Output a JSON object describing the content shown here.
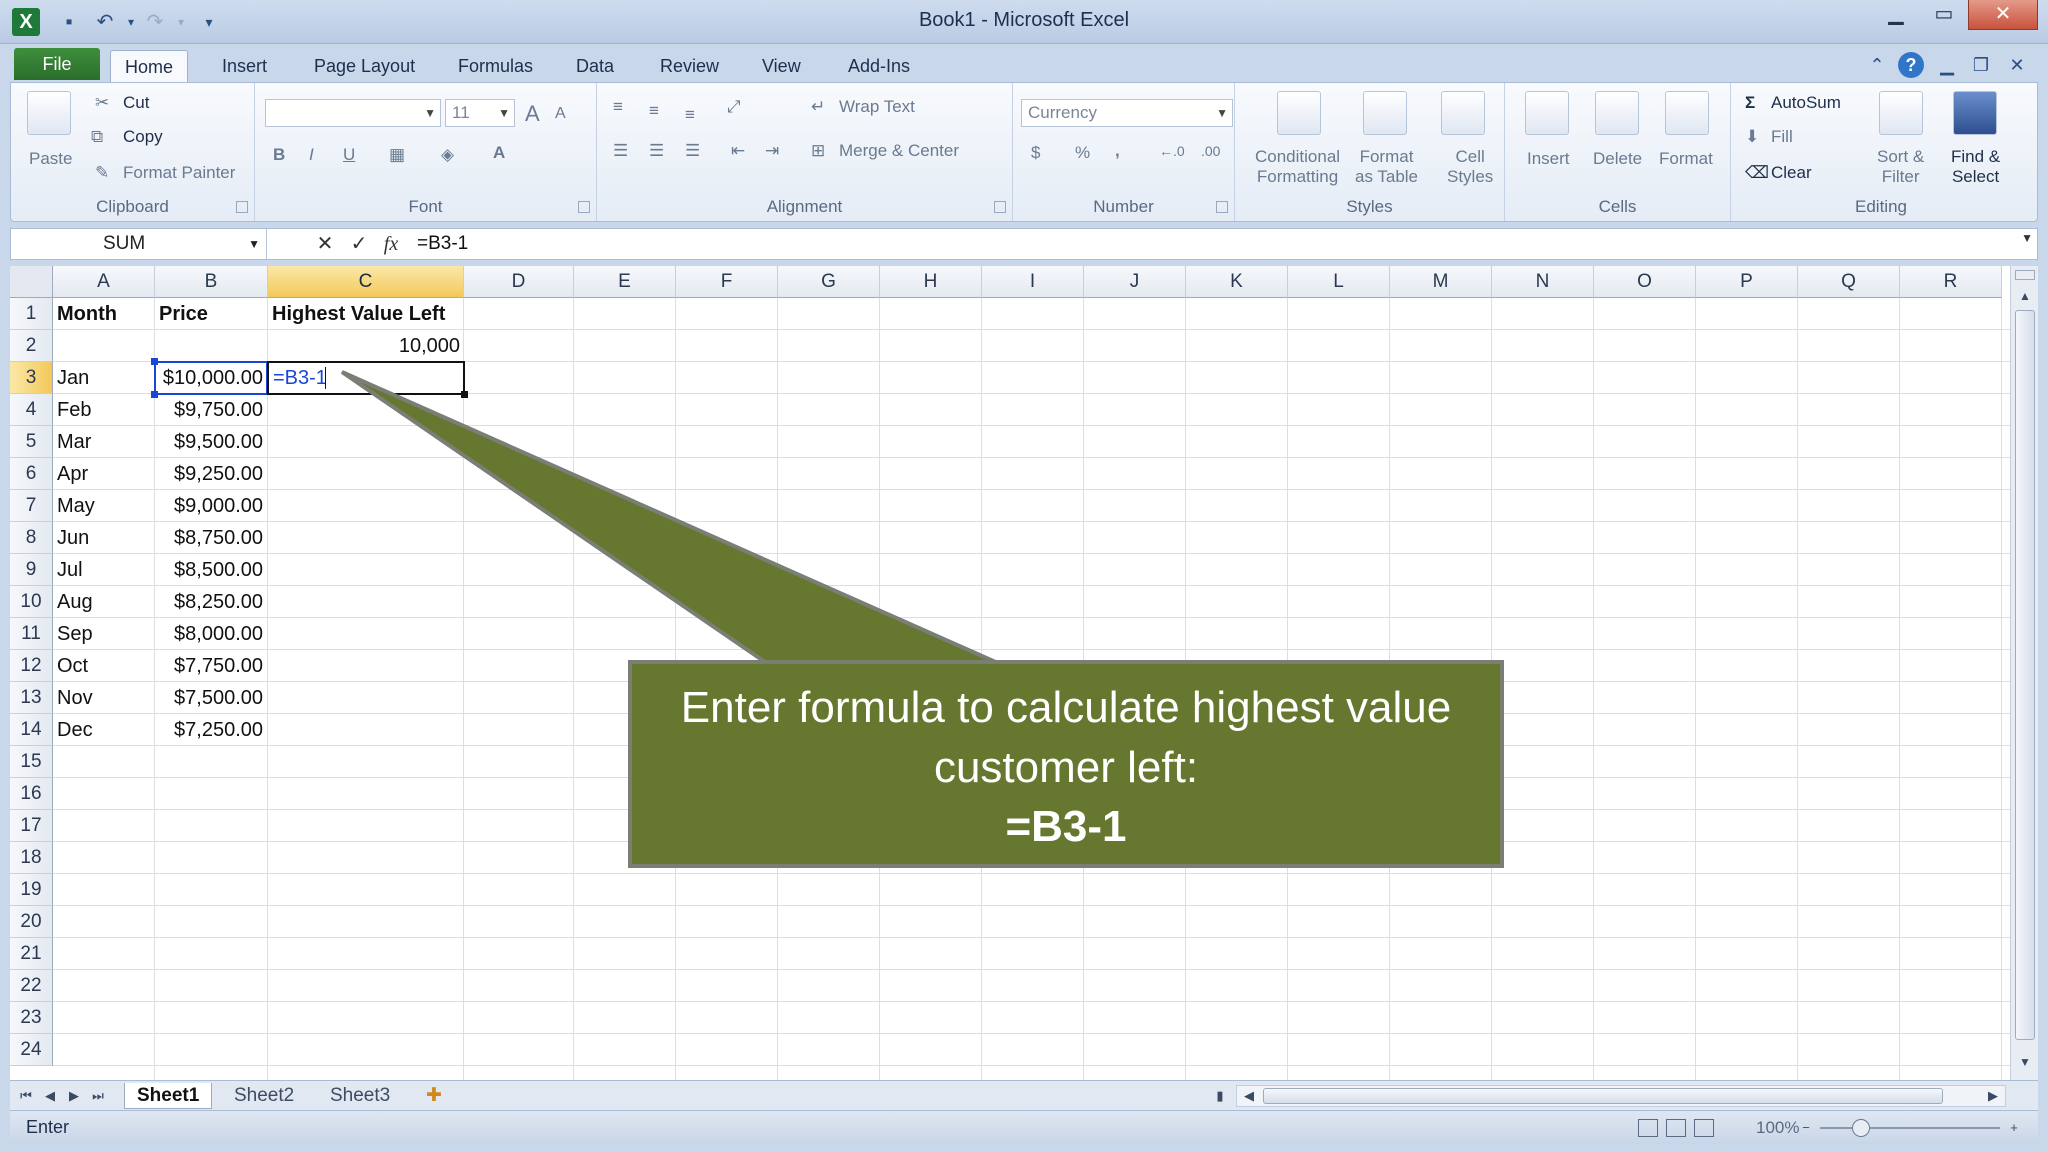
{
  "window": {
    "title": "Book1  -  Microsoft Excel",
    "minimize": "▁",
    "maximize": "▭",
    "close": "✕"
  },
  "tabs": [
    "File",
    "Home",
    "Insert",
    "Page Layout",
    "Formulas",
    "Data",
    "Review",
    "View",
    "Add-Ins"
  ],
  "ribbon": {
    "clipboard": {
      "label": "Clipboard",
      "paste": "Paste",
      "cut": "Cut",
      "copy": "Copy",
      "format_painter": "Format Painter"
    },
    "font": {
      "label": "Font",
      "font_size": "11",
      "bold": "B",
      "italic": "I",
      "underline": "U",
      "grow": "A",
      "shrink": "A",
      "color": "A"
    },
    "alignment": {
      "label": "Alignment",
      "wrap_text": "Wrap Text",
      "merge_center": "Merge & Center"
    },
    "number": {
      "label": "Number",
      "format": "Currency",
      "dollar": "$",
      "percent": "%",
      "comma": ",",
      "inc_dec": "←.0",
      "dec_dec": ".00"
    },
    "styles": {
      "label": "Styles",
      "conditional": "Conditional",
      "conditional2": "Formatting",
      "format_table": "Format",
      "format_table2": "as Table",
      "cell_styles": "Cell",
      "cell_styles2": "Styles"
    },
    "cells": {
      "label": "Cells",
      "insert": "Insert",
      "delete": "Delete",
      "format": "Format"
    },
    "editing": {
      "label": "Editing",
      "autosum": "AutoSum",
      "fill": "Fill",
      "clear": "Clear",
      "sort": "Sort &",
      "sort2": "Filter",
      "find": "Find &",
      "find2": "Select"
    }
  },
  "formula_bar": {
    "name_box": "SUM",
    "cancel": "✕",
    "enter": "✓",
    "fx": "fx",
    "formula": "=B3-1"
  },
  "columns": [
    "A",
    "B",
    "C",
    "D",
    "E",
    "F",
    "G",
    "H",
    "I",
    "J",
    "K",
    "L",
    "M",
    "N",
    "O",
    "P",
    "Q",
    "R"
  ],
  "rows": [
    "1",
    "2",
    "3",
    "4",
    "5",
    "6",
    "7",
    "8",
    "9",
    "10",
    "11",
    "12",
    "13",
    "14",
    "15",
    "16",
    "17",
    "18",
    "19",
    "20",
    "21",
    "22",
    "23",
    "24"
  ],
  "sheet": {
    "headers": {
      "a1": "Month",
      "b1": "Price",
      "c1": "Highest Value Left"
    },
    "c2": "10,000",
    "editing_cell": "=B3-1",
    "data": [
      {
        "month": "Jan",
        "price": "$10,000.00"
      },
      {
        "month": "Feb",
        "price": "$9,750.00"
      },
      {
        "month": "Mar",
        "price": "$9,500.00"
      },
      {
        "month": "Apr",
        "price": "$9,250.00"
      },
      {
        "month": "May",
        "price": "$9,000.00"
      },
      {
        "month": "Jun",
        "price": "$8,750.00"
      },
      {
        "month": "Jul",
        "price": "$8,500.00"
      },
      {
        "month": "Aug",
        "price": "$8,250.00"
      },
      {
        "month": "Sep",
        "price": "$8,000.00"
      },
      {
        "month": "Oct",
        "price": "$7,750.00"
      },
      {
        "month": "Nov",
        "price": "$7,500.00"
      },
      {
        "month": "Dec",
        "price": "$7,250.00"
      }
    ]
  },
  "sheet_tabs": [
    "Sheet1",
    "Sheet2",
    "Sheet3"
  ],
  "status": {
    "mode": "Enter",
    "zoom": "100%"
  },
  "callout": {
    "text": "Enter formula to calculate highest value customer left:",
    "formula": "=B3-1"
  },
  "colors": {
    "accent_green": "#66772f",
    "selection_blue": "#1a46d8",
    "header_highlight": "#f3c85a"
  }
}
